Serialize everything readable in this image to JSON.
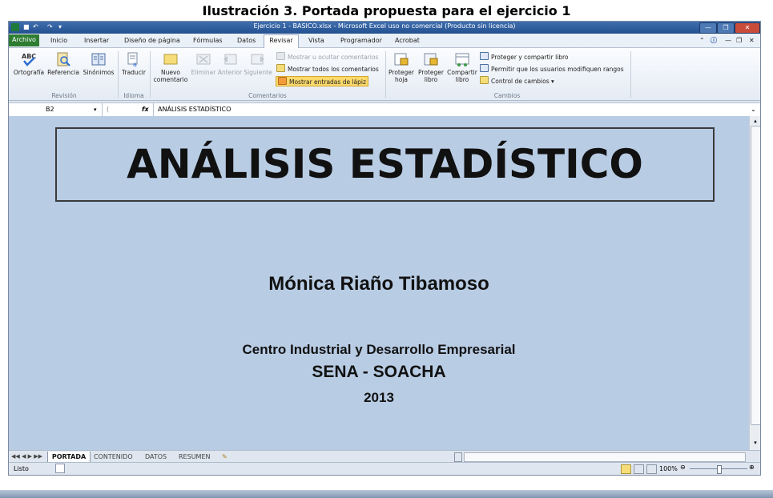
{
  "caption": "Ilustración 3. Portada propuesta para el ejercicio 1",
  "window": {
    "title": "Ejercicio 1 - BASICO.xlsx - Microsoft Excel uso no comercial (Producto sin licencia)"
  },
  "menu": {
    "tabs": [
      "Archivo",
      "Inicio",
      "Insertar",
      "Diseño de página",
      "Fórmulas",
      "Datos",
      "Revisar",
      "Vista",
      "Programador",
      "Acrobat"
    ],
    "active": "Revisar"
  },
  "ribbon": {
    "revision": {
      "ortografia": "Ortografía",
      "referencia": "Referencia",
      "sinonimos": "Sinónimos",
      "label": "Revisión"
    },
    "idioma": {
      "traducir": "Traducir",
      "label": "Idioma"
    },
    "comentarios": {
      "nuevo_1": "Nuevo",
      "nuevo_2": "comentario",
      "eliminar": "Eliminar",
      "anterior": "Anterior",
      "siguiente": "Siguiente",
      "mostrar_ocultar": "Mostrar u ocultar comentarios",
      "mostrar_todos": "Mostrar todos los comentarios",
      "mostrar_lapiz": "Mostrar entradas de lápiz",
      "label": "Comentarios"
    },
    "cambios": {
      "proteger_hoja_1": "Proteger",
      "proteger_hoja_2": "hoja",
      "proteger_libro_1": "Proteger",
      "proteger_libro_2": "libro",
      "compartir_libro_1": "Compartir",
      "compartir_libro_2": "libro",
      "proteger_compartir": "Proteger y compartir libro",
      "permitir_usuarios": "Permitir que los usuarios modifiquen rangos",
      "control_cambios": "Control de cambios",
      "label": "Cambios"
    }
  },
  "formula_bar": {
    "cell_ref": "B2",
    "fx": "fx",
    "content": "ANÁLISIS ESTADÍSTICO"
  },
  "sheet": {
    "title": "ANÁLISIS ESTADÍSTICO",
    "author": "Mónica Riaño Tibamoso",
    "center": "Centro Industrial y Desarrollo Empresarial",
    "org": "SENA - SOACHA",
    "year": "2013"
  },
  "sheet_tabs": [
    "PORTADA",
    "CONTENIDO",
    "DATOS",
    "RESUMEN"
  ],
  "active_sheet": "PORTADA",
  "status": {
    "ready": "Listo",
    "zoom": "100%"
  }
}
